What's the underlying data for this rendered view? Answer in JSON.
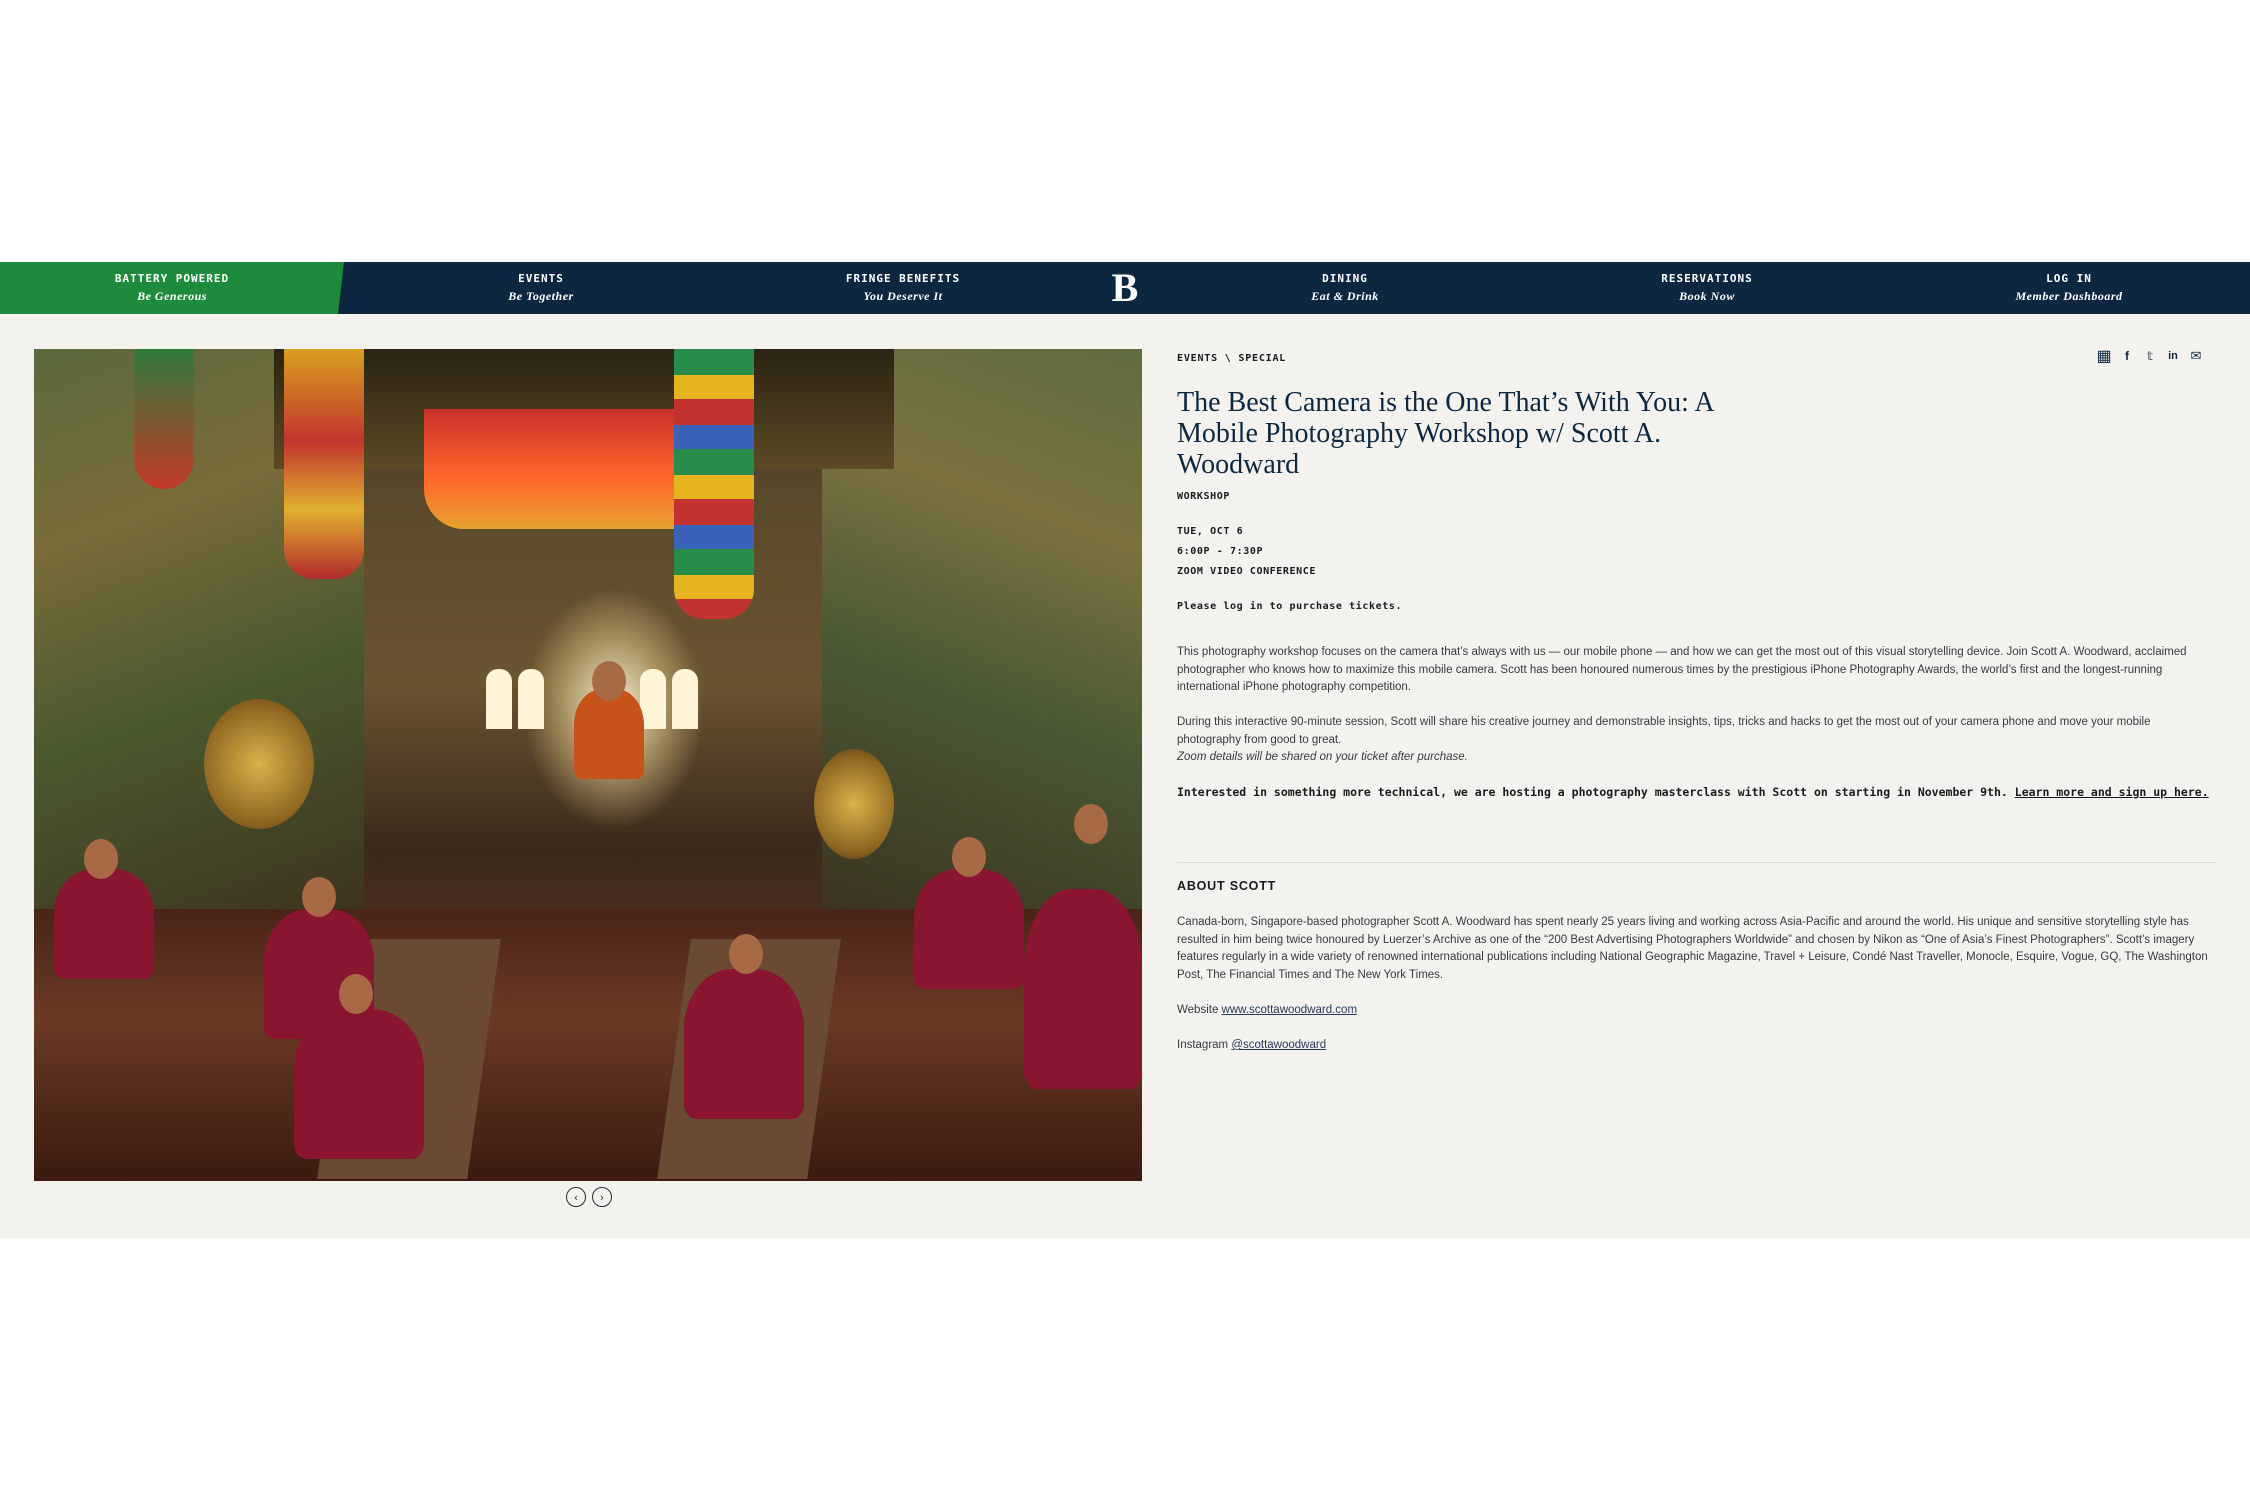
{
  "nav": {
    "promo": {
      "label": "BATTERY POWERED",
      "sub": "Be Generous"
    },
    "items": [
      {
        "label": "EVENTS",
        "sub": "Be Together"
      },
      {
        "label": "FRINGE BENEFITS",
        "sub": "You Deserve It"
      },
      {
        "label": "DINING",
        "sub": "Eat & Drink"
      },
      {
        "label": "RESERVATIONS",
        "sub": "Book Now"
      },
      {
        "label": "LOG IN",
        "sub": "Member Dashboard"
      }
    ],
    "logo": "B",
    "colors": {
      "nav_bg": "#0d2741",
      "promo_bg": "#1e8a3c",
      "page_bg": "#f3f2ee"
    }
  },
  "carousel": {
    "prev_icon": "‹",
    "next_icon": "›"
  },
  "event": {
    "breadcrumb": "EVENTS \\ SPECIAL",
    "share_icons": [
      "calendar-icon",
      "facebook-icon",
      "twitter-icon",
      "linkedin-icon",
      "email-icon"
    ],
    "share_glyphs": [
      "▦",
      "f",
      "𝕥",
      "in",
      "✉"
    ],
    "title": "The Best Camera is the One That’s With You: A Mobile Photography Workshop w/ Scott A. Woodward",
    "category": "WORKSHOP",
    "date": "TUE, OCT 6",
    "time": "6:00P - 7:30P",
    "location": "ZOOM VIDEO CONFERENCE",
    "login_note": "Please log in to purchase tickets.",
    "description_1": "This photography workshop focuses on the camera that’s always with us — our mobile phone — and how we can get the most out of this visual storytelling device. Join Scott A. Woodward, acclaimed photographer who knows how to maximize this mobile camera. Scott has been honoured numerous times by the prestigious iPhone Photography Awards, the world’s first and the longest-running international iPhone photography competition.",
    "description_2": "During this interactive 90-minute session, Scott will share his creative journey and demonstrable insights, tips, tricks and hacks to get the most out of your camera phone and move your mobile photography from good to great.",
    "zoom_note": "Zoom details will be shared on your ticket after purchase.",
    "masterclass_text": "Interested in something more technical, we are hosting a photography masterclass with Scott on starting in November 9th. ",
    "masterclass_link": "Learn more and sign up here. "
  },
  "about": {
    "heading": "ABOUT SCOTT",
    "bio": "Canada-born, Singapore-based photographer Scott A. Woodward has spent nearly 25 years living and working across Asia-Pacific and around the world. His unique and sensitive storytelling style has resulted in him being twice honoured by Luerzer’s Archive as one of the “200 Best Advertising Photographers Worldwide” and chosen by Nikon as “One of Asia’s Finest Photographers”. Scott’s imagery features regularly in a wide variety of renowned international publications including National Geographic Magazine, Travel + Leisure, Condé Nast Traveller, Monocle, Esquire, Vogue, GQ, The Washington Post, The Financial Times and The New York Times.",
    "website_label": "Website ",
    "website_link": "www.scottawoodward.com",
    "instagram_label": "Instagram ",
    "instagram_link": "@scottawoodward"
  }
}
